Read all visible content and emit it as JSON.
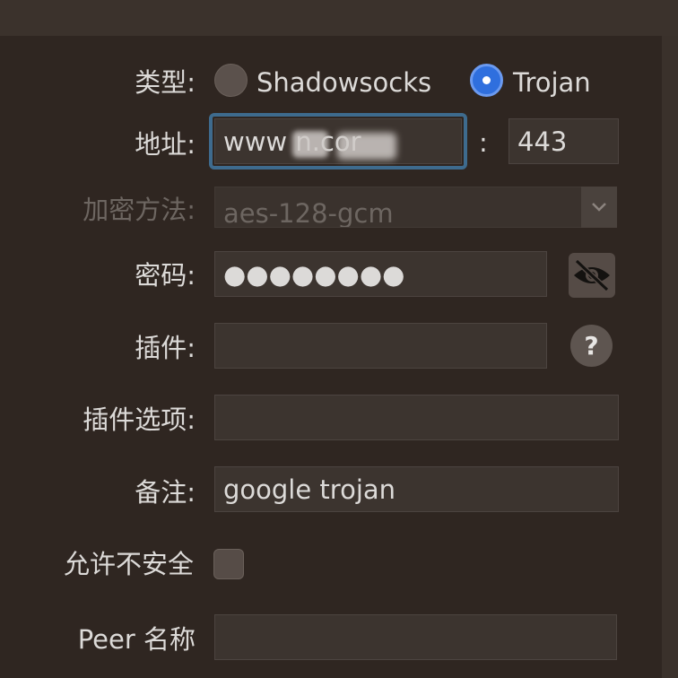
{
  "form": {
    "type_label": "类型:",
    "type_options": [
      "Shadowsocks",
      "Trojan"
    ],
    "type_selected": "Trojan",
    "address_label": "地址:",
    "address_value": "www        n.cor",
    "colon": ":",
    "port_value": "443",
    "encryption_label": "加密方法:",
    "encryption_value": "aes-128-gcm",
    "password_label": "密码:",
    "password_value": "●●●●●●●●",
    "plugin_label": "插件:",
    "plugin_value": "",
    "plugin_help": "?",
    "plugin_options_label": "插件选项:",
    "plugin_options_value": "",
    "remark_label": "备注:",
    "remark_value": "google trojan",
    "allow_insecure_label": "允许不安全",
    "allow_insecure_checked": false,
    "peer_label": "Peer 名称",
    "peer_value": ""
  },
  "icons": {
    "select_arrow": "chevron-down-icon",
    "toggle_password": "eye-slash-icon",
    "help": "question-mark-icon"
  },
  "colors": {
    "accent": "#2f6fde",
    "focus_ring": "#3e6b8e",
    "panel_bg": "#2f2621"
  }
}
